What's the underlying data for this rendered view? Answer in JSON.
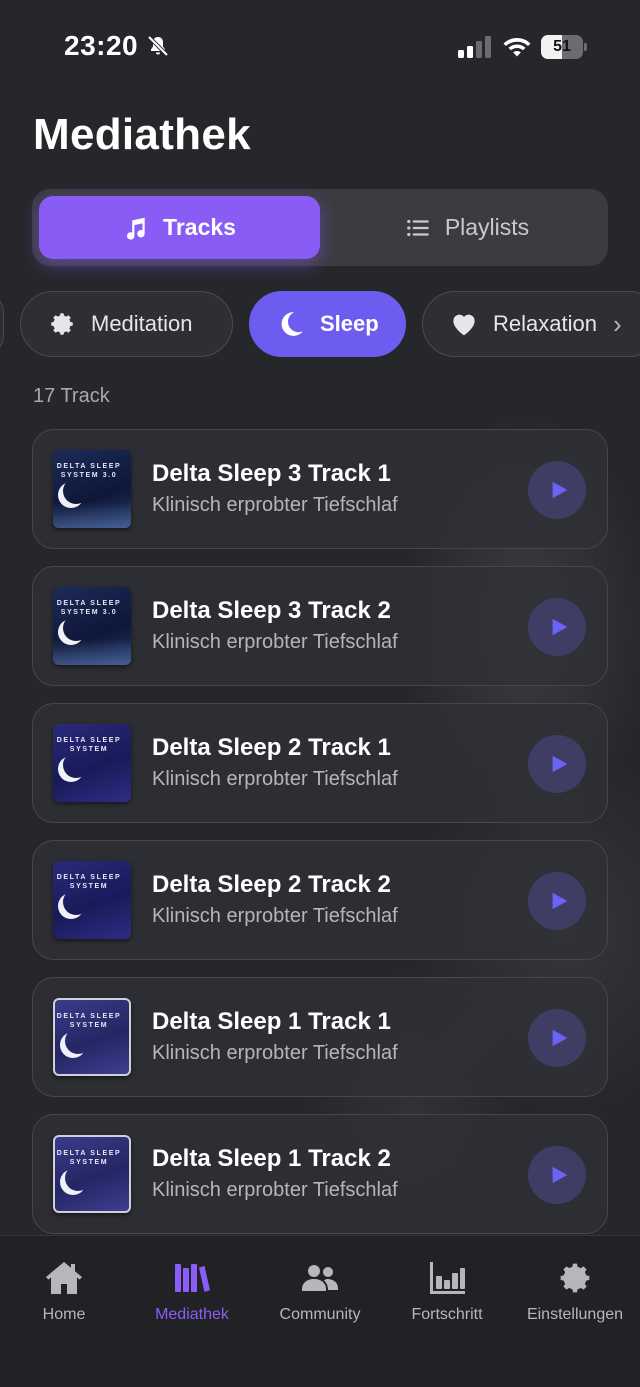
{
  "status_bar": {
    "time": "23:20",
    "battery": "51",
    "battery_level": 0.51
  },
  "page": {
    "title": "Mediathek"
  },
  "segmented": {
    "tracks_label": "Tracks",
    "playlists_label": "Playlists",
    "selected": "Tracks"
  },
  "categories": {
    "items": [
      "Meditation",
      "Sleep",
      "Relaxation"
    ],
    "selected": "Sleep"
  },
  "track_count": "17 Track",
  "tracks": [
    {
      "title": "Delta Sleep 3 Track 1",
      "subtitle": "Klinisch erprobter Tiefschlaf",
      "cover_text": "DELTA SLEEP SYSTEM 3.0"
    },
    {
      "title": "Delta Sleep 3 Track 2",
      "subtitle": "Klinisch erprobter Tiefschlaf",
      "cover_text": "DELTA SLEEP SYSTEM 3.0"
    },
    {
      "title": "Delta Sleep 2 Track 1",
      "subtitle": "Klinisch erprobter Tiefschlaf",
      "cover_text": "DELTA SLEEP SYSTEM"
    },
    {
      "title": "Delta Sleep 2 Track 2",
      "subtitle": "Klinisch erprobter Tiefschlaf",
      "cover_text": "DELTA SLEEP SYSTEM"
    },
    {
      "title": "Delta Sleep 1 Track 1",
      "subtitle": "Klinisch erprobter Tiefschlaf",
      "cover_text": "DELTA SLEEP SYSTEM"
    },
    {
      "title": "Delta Sleep 1 Track 2",
      "subtitle": "Klinisch erprobter Tiefschlaf",
      "cover_text": "DELTA SLEEP SYSTEM"
    }
  ],
  "tabbar": {
    "home": "Home",
    "library": "Mediathek",
    "community": "Community",
    "progress": "Fortschritt",
    "settings": "Einstellungen",
    "active": "Mediathek"
  },
  "colors": {
    "accent": "#8a5cf6",
    "chip_active": "#6c5cf0",
    "background": "#26272b",
    "play_icon": "#6b63f5"
  }
}
